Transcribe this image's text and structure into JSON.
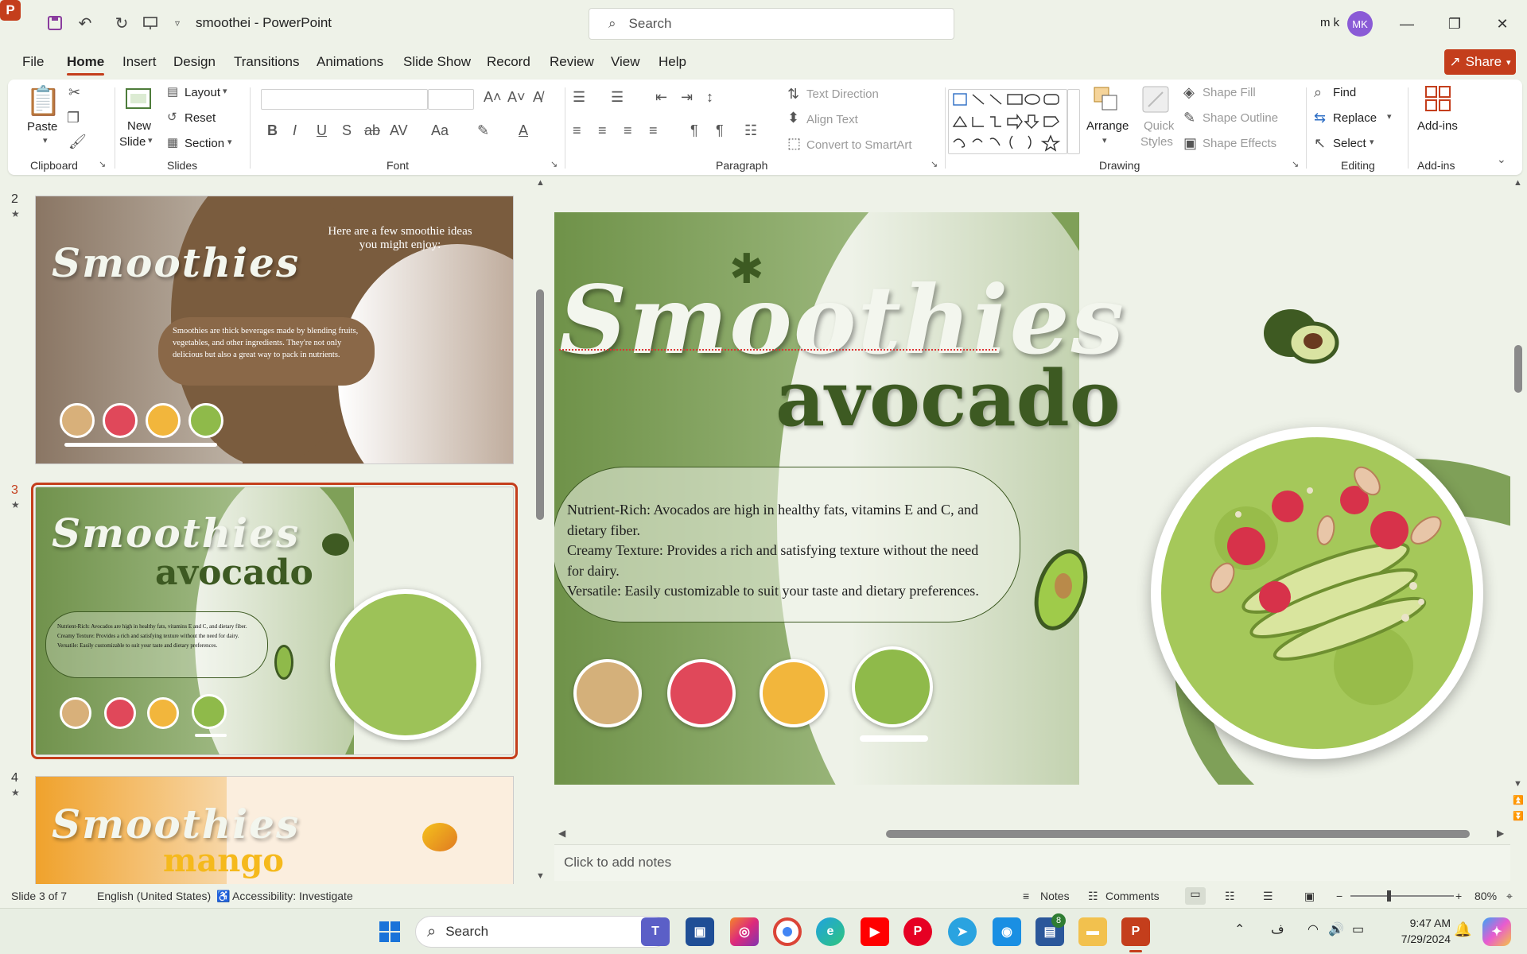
{
  "titlebar": {
    "doc_title": "smoothei  -  PowerPoint",
    "search_placeholder": "Search",
    "user_name": "m k",
    "avatar_initials": "MK"
  },
  "menu": {
    "tabs": [
      "File",
      "Home",
      "Insert",
      "Design",
      "Transitions",
      "Animations",
      "Slide Show",
      "Record",
      "Review",
      "View",
      "Help"
    ],
    "active_tab": "Home",
    "share_label": "Share"
  },
  "ribbon": {
    "clipboard": {
      "paste": "Paste",
      "label": "Clipboard"
    },
    "slides": {
      "new_slide_1": "New",
      "new_slide_2": "Slide",
      "layout": "Layout",
      "reset": "Reset",
      "section": "Section",
      "label": "Slides"
    },
    "font": {
      "label": "Font"
    },
    "paragraph": {
      "text_direction": "Text Direction",
      "align_text": "Align Text",
      "convert_smartart": "Convert to SmartArt",
      "label": "Paragraph"
    },
    "drawing": {
      "arrange": "Arrange",
      "quick_styles_1": "Quick",
      "quick_styles_2": "Styles",
      "shape_fill": "Shape Fill",
      "shape_outline": "Shape Outline",
      "shape_effects": "Shape Effects",
      "label": "Drawing"
    },
    "editing": {
      "find": "Find",
      "replace": "Replace",
      "select": "Select",
      "label": "Editing"
    },
    "addins": {
      "addins": "Add-ins",
      "label": "Add-ins"
    }
  },
  "thumbnails": [
    {
      "num": "2",
      "title": "Smoothies",
      "heading": "Here are a few smoothie ideas you might enjoy:",
      "body": "Smoothies are thick beverages made by blending fruits, vegetables, and other ingredients. They're not only delicious but also a great way to pack in nutrients."
    },
    {
      "num": "3",
      "title": "Smoothies",
      "subtitle": "avocado",
      "body": "Nutrient-Rich: Avocados are high in healthy fats, vitamins E and C, and dietary fiber. Creamy Texture: Provides a rich and satisfying texture without the need for dairy. Versatile: Easily customizable to suit your taste and dietary preferences."
    },
    {
      "num": "4",
      "title": "Smoothies",
      "subtitle": "mango"
    }
  ],
  "slide": {
    "title": "Smoothies",
    "subtitle": "avocado",
    "lines": [
      "Nutrient-Rich: Avocados are high in healthy fats, vitamins E and C, and",
      "dietary fiber.",
      "Creamy Texture: Provides a rich and satisfying texture without the need",
      "for dairy.",
      "Versatile: Easily customizable to suit your taste and dietary preferences."
    ]
  },
  "notes_placeholder": "Click to add notes",
  "status": {
    "slide_count": "Slide 3 of 7",
    "language": "English (United States)",
    "accessibility": "Accessibility: Investigate",
    "notes": "Notes",
    "comments": "Comments",
    "zoom": "80%"
  },
  "taskbar": {
    "search": "Search",
    "time": "9:47 AM",
    "date": "7/29/2024",
    "lang": "ف",
    "badge": "8"
  },
  "colors": {
    "accent": "#c43e1c",
    "slide_green": "#7fa058",
    "title_green": "#3d5a22"
  }
}
